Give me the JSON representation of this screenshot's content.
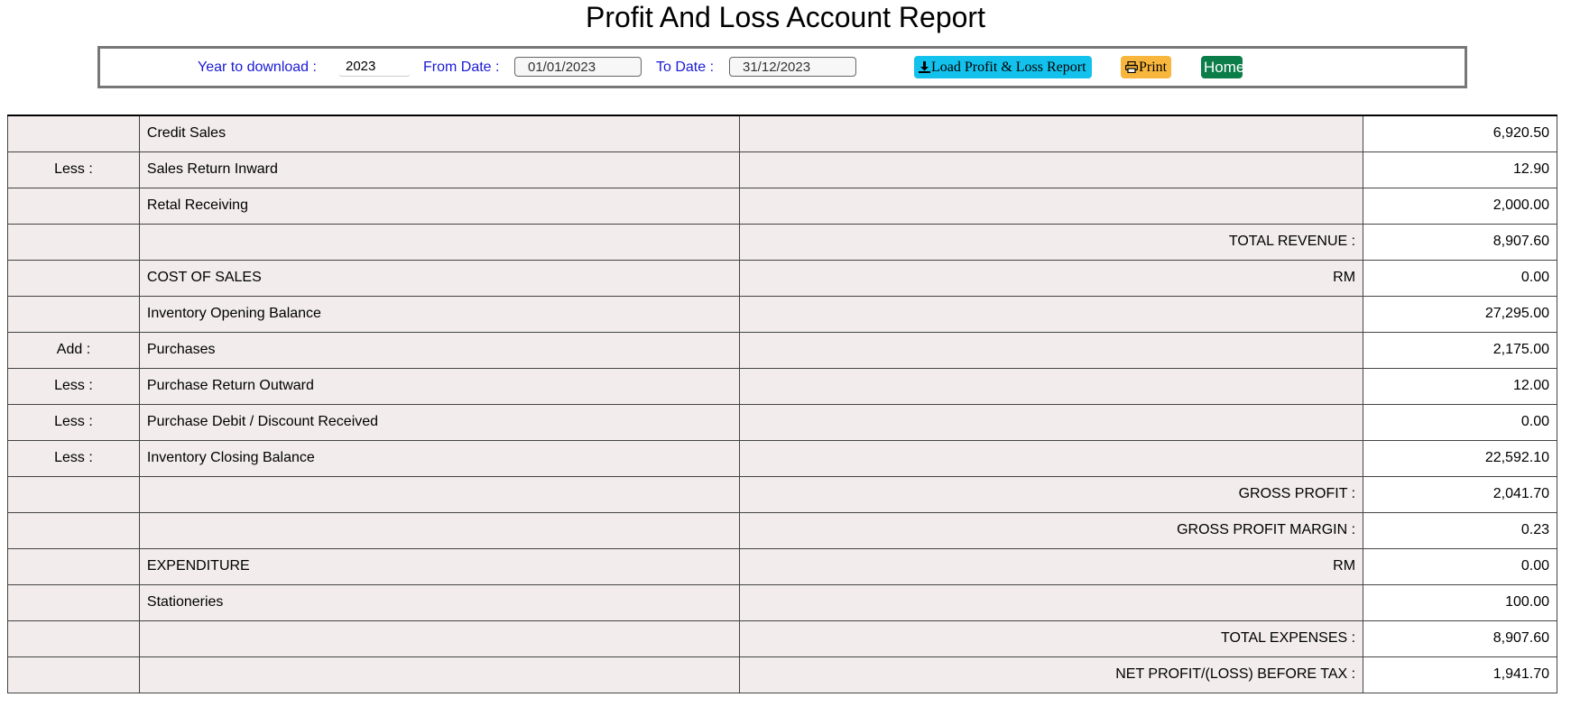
{
  "title": "Profit And Loss Account Report",
  "toolbar": {
    "year_label": "Year to download :",
    "year_value": "2023",
    "from_label": "From Date :",
    "from_value": "01/01/2023",
    "to_label": "To Date :",
    "to_value": "31/12/2023",
    "load_button": "Load Profit & Loss Report",
    "print_button": "Print",
    "home_button": "Home",
    "colors": {
      "label": "#1a1ad6",
      "load_button": "#13c2ec",
      "print_button": "#f8b63c",
      "home_button": "#0b7d48"
    }
  },
  "rows": [
    {
      "prefix": "",
      "item": "Credit Sales",
      "label": "",
      "amount": "6,920.50"
    },
    {
      "prefix": "Less :",
      "item": "Sales Return Inward",
      "label": "",
      "amount": "12.90"
    },
    {
      "prefix": "",
      "item": "Retal Receiving",
      "label": "",
      "amount": "2,000.00"
    },
    {
      "prefix": "",
      "item": "",
      "label": "TOTAL REVENUE :",
      "amount": "8,907.60"
    },
    {
      "prefix": "",
      "item": "COST OF SALES",
      "label": "RM",
      "amount": "0.00"
    },
    {
      "prefix": "",
      "item": "Inventory Opening Balance",
      "label": "",
      "amount": "27,295.00"
    },
    {
      "prefix": "Add :",
      "item": "Purchases",
      "label": "",
      "amount": "2,175.00"
    },
    {
      "prefix": "Less :",
      "item": "Purchase Return Outward",
      "label": "",
      "amount": "12.00"
    },
    {
      "prefix": "Less :",
      "item": "Purchase Debit / Discount Received",
      "label": "",
      "amount": "0.00"
    },
    {
      "prefix": "Less :",
      "item": "Inventory Closing Balance",
      "label": "",
      "amount": "22,592.10"
    },
    {
      "prefix": "",
      "item": "",
      "label": "GROSS PROFIT :",
      "amount": "2,041.70"
    },
    {
      "prefix": "",
      "item": "",
      "label": "GROSS PROFIT MARGIN :",
      "amount": "0.23"
    },
    {
      "prefix": "",
      "item": "EXPENDITURE",
      "label": "RM",
      "amount": "0.00"
    },
    {
      "prefix": "",
      "item": "Stationeries",
      "label": "",
      "amount": "100.00"
    },
    {
      "prefix": "",
      "item": "",
      "label": "TOTAL EXPENSES :",
      "amount": "8,907.60"
    },
    {
      "prefix": "",
      "item": "",
      "label": "NET PROFIT/(LOSS) BEFORE TAX :",
      "amount": "1,941.70"
    }
  ]
}
